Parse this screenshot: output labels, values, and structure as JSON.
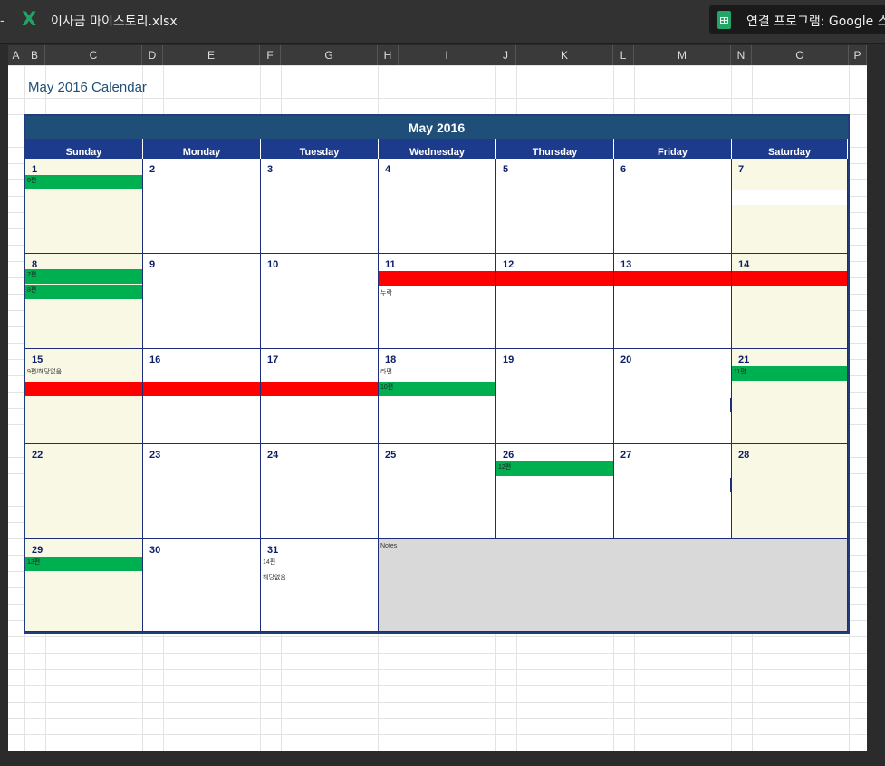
{
  "topbar": {
    "file_name": "이사금 마이스토리.xlsx",
    "excel_icon_glyph": "X",
    "open_with_label": "연결 프로그램: Google 스프레드시트"
  },
  "columns": [
    "A",
    "B",
    "C",
    "D",
    "E",
    "F",
    "G",
    "H",
    "I",
    "J",
    "K",
    "L",
    "M",
    "N",
    "O",
    "P"
  ],
  "sheet_title": "May 2016 Calendar",
  "calendar": {
    "title": "May 2016",
    "days": [
      "Sunday",
      "Monday",
      "Tuesday",
      "Wednesday",
      "Thursday",
      "Friday",
      "Saturday"
    ],
    "weeks": [
      [
        {
          "n": "1",
          "w": true
        },
        {
          "n": "2"
        },
        {
          "n": "3"
        },
        {
          "n": "4"
        },
        {
          "n": "5"
        },
        {
          "n": "6"
        },
        {
          "n": "7",
          "w": true
        }
      ],
      [
        {
          "n": "8",
          "w": true
        },
        {
          "n": "9"
        },
        {
          "n": "10"
        },
        {
          "n": "11"
        },
        {
          "n": "12"
        },
        {
          "n": "13"
        },
        {
          "n": "14",
          "w": true
        }
      ],
      [
        {
          "n": "15",
          "w": true
        },
        {
          "n": "16"
        },
        {
          "n": "17"
        },
        {
          "n": "18"
        },
        {
          "n": "19"
        },
        {
          "n": "20"
        },
        {
          "n": "21",
          "w": true
        }
      ],
      [
        {
          "n": "22",
          "w": true
        },
        {
          "n": "23"
        },
        {
          "n": "24"
        },
        {
          "n": "25"
        },
        {
          "n": "26"
        },
        {
          "n": "27"
        },
        {
          "n": "28",
          "w": true
        }
      ],
      [
        {
          "n": "29",
          "w": true
        },
        {
          "n": "30"
        },
        {
          "n": "31"
        }
      ]
    ],
    "notes_label": "Notes",
    "events": {
      "d1": "6편",
      "d8a": "7편",
      "d8b": "8편",
      "d11": "누락",
      "d15": "9편/해당없음",
      "d18a": "라면",
      "d18b": "10편",
      "d21": "11편",
      "d26": "12편",
      "d29": "13편",
      "d31a": "14편",
      "d31b": "해당없음"
    },
    "colors": {
      "green": "#00b050",
      "red": "#ff0000",
      "header": "#1f4e79",
      "dayrow": "#1d3b8c",
      "weekend": "#f8f8e4",
      "notes": "#d9d9d9"
    }
  }
}
